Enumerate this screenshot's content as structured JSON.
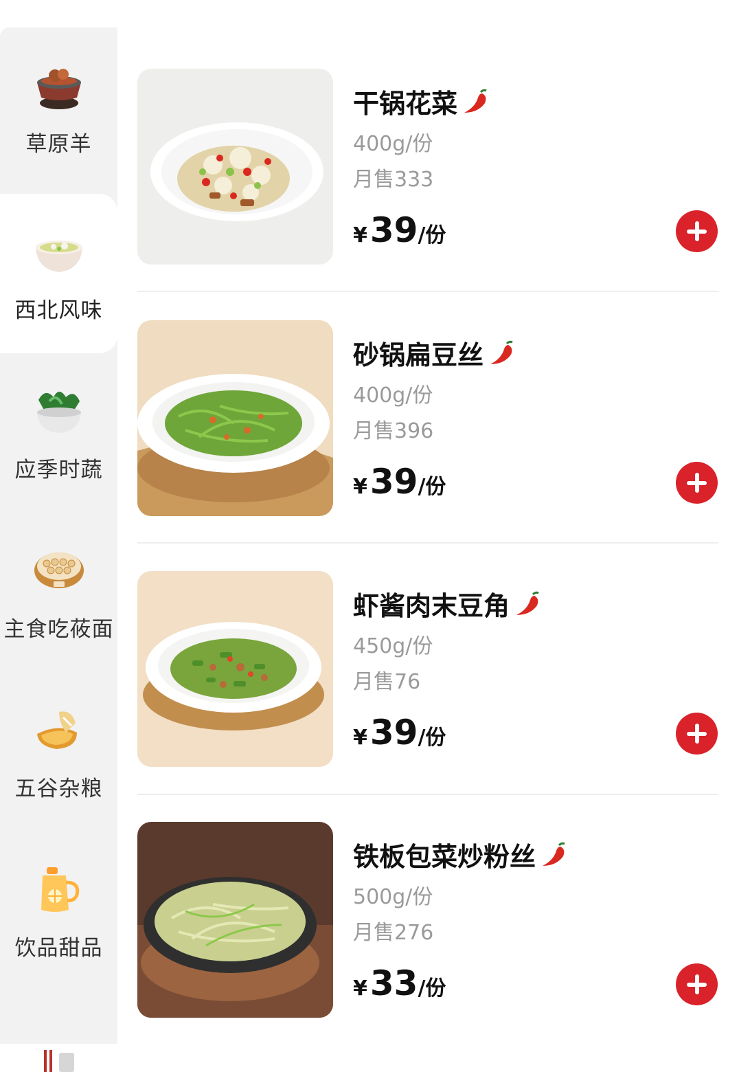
{
  "categories": [
    {
      "label": "草原羊",
      "icon": "mutton-hotpot-icon",
      "active": false
    },
    {
      "label": "西北风味",
      "icon": "soup-bowl-icon",
      "active": true
    },
    {
      "label": "应季时蔬",
      "icon": "greens-bowl-icon",
      "active": false
    },
    {
      "label": "主食吃莜面",
      "icon": "steamer-icon",
      "active": false
    },
    {
      "label": "五谷杂粮",
      "icon": "pancake-icon",
      "active": false
    },
    {
      "label": "饮品甜品",
      "icon": "drink-jug-icon",
      "active": false
    }
  ],
  "products": [
    {
      "name": "干锅花菜",
      "spec": "400g/份",
      "sales": "月售333",
      "currency": "¥",
      "price": "39",
      "unit": "/份",
      "spicy": true
    },
    {
      "name": "砂锅扁豆丝",
      "spec": "400g/份",
      "sales": "月售396",
      "currency": "¥",
      "price": "39",
      "unit": "/份",
      "spicy": true
    },
    {
      "name": "虾酱肉末豆角",
      "spec": "450g/份",
      "sales": "月售76",
      "currency": "¥",
      "price": "39",
      "unit": "/份",
      "spicy": true
    },
    {
      "name": "铁板包菜炒粉丝",
      "spec": "500g/份",
      "sales": "月售276",
      "currency": "¥",
      "price": "33",
      "unit": "/份",
      "spicy": true
    }
  ],
  "colors": {
    "accent": "#d9222a",
    "sidebar_bg": "#f2f2f2",
    "muted_text": "#9a9a9a"
  }
}
